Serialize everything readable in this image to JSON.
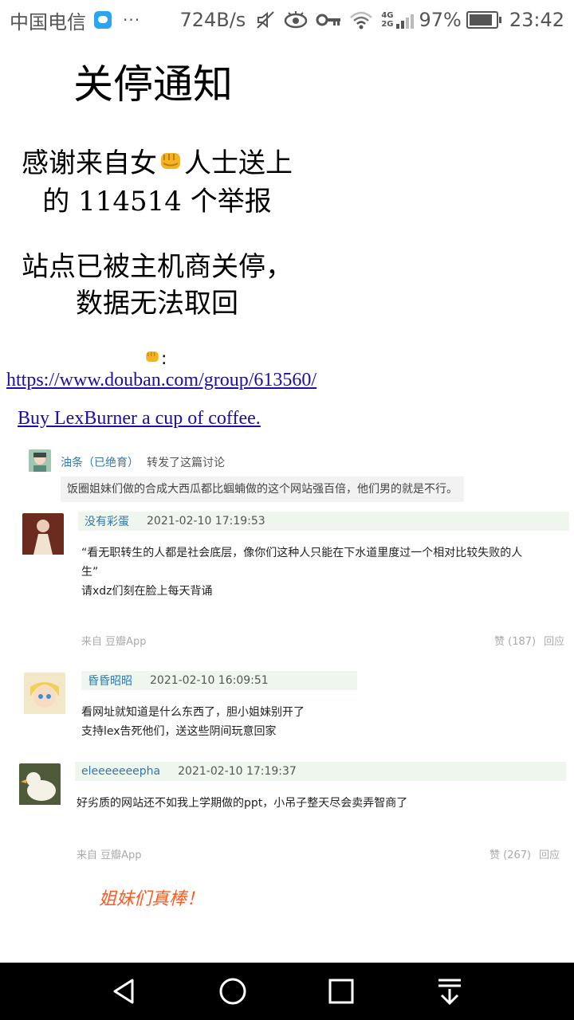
{
  "status_bar": {
    "carrier": "中国电信",
    "more": "···",
    "speed": "724B/s",
    "net_top": "4G",
    "net_bottom": "2G",
    "battery_pct": "97%",
    "time": "23:42"
  },
  "notice": {
    "title": "关停通知",
    "line1_a": "感谢来自女",
    "line1_b": "人士送上",
    "line2": "的 114514 个举报",
    "line3": "站点已被主机商关停，",
    "line4": "数据无法取回",
    "source_suffix": ":",
    "source_url": "https://www.douban.com/group/613560/",
    "coffee_link": "Buy LexBurner a cup of coffee."
  },
  "screenshot": {
    "forward": {
      "user": "油条（已绝育）",
      "action": "转发了这篇讨论",
      "quote": "饭圈姐妹们做的合成大西瓜都比蝈蝻做的这个网站强百倍，他们男的就是不行。"
    },
    "comments": [
      {
        "user": "没有彩蛋",
        "time": "2021-02-10 17:19:53",
        "lines": [
          "“看无职转生的人都是社会底层，像你们这种人只能在下水道里度过一个相对比较失败的人",
          "生”",
          "请xdz们刻在脸上每天背诵"
        ],
        "source": "来自 豆瓣App",
        "likes": "赞 (187)",
        "reply": "回应"
      },
      {
        "user": "昏昏昭昭",
        "time": "2021-02-10 16:09:51",
        "lines": [
          "看网址就知道是什么东西了，胆小姐妹别开了",
          "支持lex告死他们，送这些阴间玩意回家"
        ]
      },
      {
        "user": "eleeeeeeepha",
        "time": "2021-02-10 17:19:37",
        "lines": [
          "好劣质的网站还不如我上学期做的ppt，小吊子整天尽会卖弄智商了"
        ],
        "source": "来自 豆瓣App",
        "likes": "赞 (267)",
        "reply": "回应"
      }
    ],
    "cheer": "姐妹们真棒！"
  },
  "nav": {
    "back": "back-icon",
    "home": "home-icon",
    "recents": "recents-icon",
    "menu": "pull-down-icon"
  }
}
